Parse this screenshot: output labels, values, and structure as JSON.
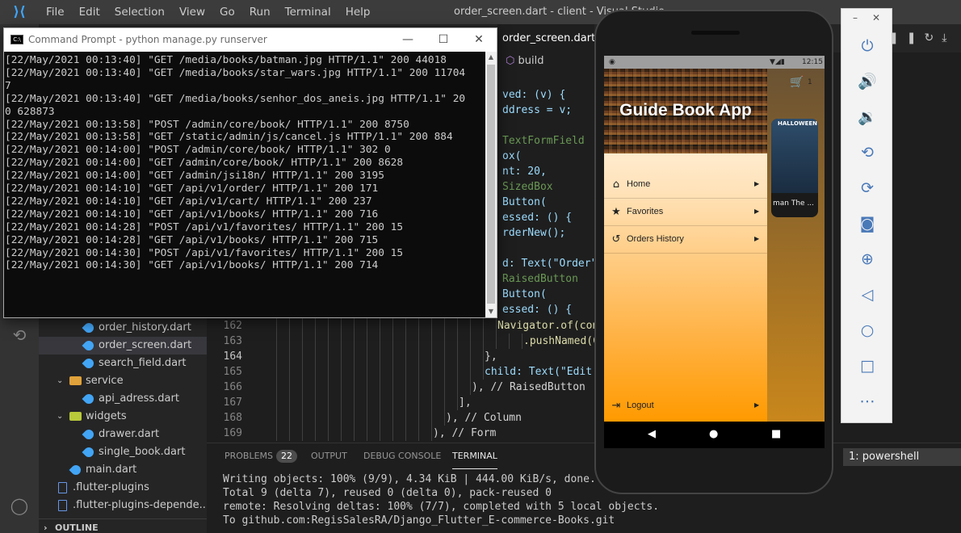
{
  "vscode": {
    "menu": [
      "File",
      "Edit",
      "Selection",
      "View",
      "Go",
      "Run",
      "Terminal",
      "Help"
    ],
    "window_title": "order_screen.dart - client - Visual Studio",
    "active_tab": "order_screen.dart",
    "breadcrumb": "build",
    "explorer": [
      {
        "label": "order_history.dart",
        "kind": "dart",
        "indent": 3
      },
      {
        "label": "order_screen.dart",
        "kind": "dart",
        "indent": 3,
        "active": true
      },
      {
        "label": "search_field.dart",
        "kind": "dart",
        "indent": 3
      },
      {
        "label": "service",
        "kind": "folder",
        "indent": 2
      },
      {
        "label": "api_adress.dart",
        "kind": "dart",
        "indent": 3
      },
      {
        "label": "widgets",
        "kind": "folder",
        "indent": 2
      },
      {
        "label": "drawer.dart",
        "kind": "dart",
        "indent": 3
      },
      {
        "label": "single_book.dart",
        "kind": "dart",
        "indent": 3
      },
      {
        "label": "main.dart",
        "kind": "dart",
        "indent": 2
      },
      {
        "label": ".flutter-plugins",
        "kind": "file",
        "indent": 1
      },
      {
        "label": ".flutter-plugins-depende...",
        "kind": "file",
        "indent": 1
      }
    ],
    "outline_label": "OUTLINE",
    "code_top": [
      {
        "text": "ved: (v) {"
      },
      {
        "text": "ddress = v;"
      },
      {
        "text": ""
      },
      {
        "text": "TextFormField"
      },
      {
        "text": "ox("
      },
      {
        "text": "nt: 20,"
      },
      {
        "text": "SizedBox"
      },
      {
        "text": "Button("
      },
      {
        "text": "essed: () {"
      },
      {
        "text": "rderNew();"
      },
      {
        "text": ""
      },
      {
        "text": "d: Text(\"Order\"),"
      },
      {
        "text": "RaisedButton"
      },
      {
        "text": "Button("
      },
      {
        "text": "essed: () {"
      }
    ],
    "code_bottom": [
      {
        "num": "162",
        "text": "Navigator.of(conte",
        "indent": 274
      },
      {
        "num": "163",
        "text": ".pushNamed(Car",
        "indent": 306
      },
      {
        "num": "164",
        "text": "},",
        "indent": 258,
        "current": true
      },
      {
        "num": "165",
        "text": "child: Text(\"Edit Ca",
        "indent": 258
      },
      {
        "num": "166",
        "text": "), // RaisedButton",
        "indent": 242
      },
      {
        "num": "167",
        "text": "],",
        "indent": 226
      },
      {
        "num": "168",
        "text": "), // Column",
        "indent": 210
      },
      {
        "num": "169",
        "text": "), // Form",
        "indent": 194
      }
    ],
    "panel": {
      "tabs": [
        "PROBLEMS",
        "OUTPUT",
        "DEBUG CONSOLE",
        "TERMINAL"
      ],
      "problems_count": "22",
      "terminal_select": "1: powershell",
      "lines": [
        "Writing objects: 100% (9/9), 4.34 KiB | 444.00 KiB/s, done.",
        "Total 9 (delta 7), reused 0 (delta 0), pack-reused 0",
        "remote: Resolving deltas: 100% (7/7), completed with 5 local objects.",
        "To github.com:RegisSalesRA/Django_Flutter_E-commerce-Books.git"
      ]
    }
  },
  "cmd": {
    "title": "Command Prompt - python  manage.py runserver",
    "lines": [
      "[22/May/2021 00:13:40] \"GET /media/books/batman.jpg HTTP/1.1\" 200 44018",
      "[22/May/2021 00:13:40] \"GET /media/books/star_wars.jpg HTTP/1.1\" 200 11704",
      "7",
      "[22/May/2021 00:13:40] \"GET /media/books/senhor_dos_aneis.jpg HTTP/1.1\" 20",
      "0 628873",
      "[22/May/2021 00:13:58] \"POST /admin/core/book/ HTTP/1.1\" 200 8750",
      "[22/May/2021 00:13:58] \"GET /static/admin/js/cancel.js HTTP/1.1\" 200 884",
      "[22/May/2021 00:14:00] \"POST /admin/core/book/ HTTP/1.1\" 302 0",
      "[22/May/2021 00:14:00] \"GET /admin/core/book/ HTTP/1.1\" 200 8628",
      "[22/May/2021 00:14:00] \"GET /admin/jsi18n/ HTTP/1.1\" 200 3195",
      "[22/May/2021 00:14:10] \"GET /api/v1/order/ HTTP/1.1\" 200 171",
      "[22/May/2021 00:14:10] \"GET /api/v1/cart/ HTTP/1.1\" 200 237",
      "[22/May/2021 00:14:10] \"GET /api/v1/books/ HTTP/1.1\" 200 716",
      "[22/May/2021 00:14:28] \"POST /api/v1/favorites/ HTTP/1.1\" 200 15",
      "[22/May/2021 00:14:28] \"GET /api/v1/books/ HTTP/1.1\" 200 715",
      "[22/May/2021 00:14:30] \"POST /api/v1/favorites/ HTTP/1.1\" 200 15",
      "[22/May/2021 00:14:30] \"GET /api/v1/books/ HTTP/1.1\" 200 714"
    ]
  },
  "phone": {
    "status_time": "12:15",
    "cart_count": "1",
    "drawer_title": "Guide Book App",
    "drawer_items": [
      {
        "label": "Home",
        "icon": "home-icon"
      },
      {
        "label": "Favorites",
        "icon": "star-icon"
      },
      {
        "label": "Orders History",
        "icon": "history-icon"
      }
    ],
    "logout_label": "Logout",
    "book_badge": "HALLOWEEN",
    "book_title": "man The ..."
  },
  "colors": {
    "accent": "#007acc",
    "drawer_gradient_end": "#ff9a00"
  }
}
